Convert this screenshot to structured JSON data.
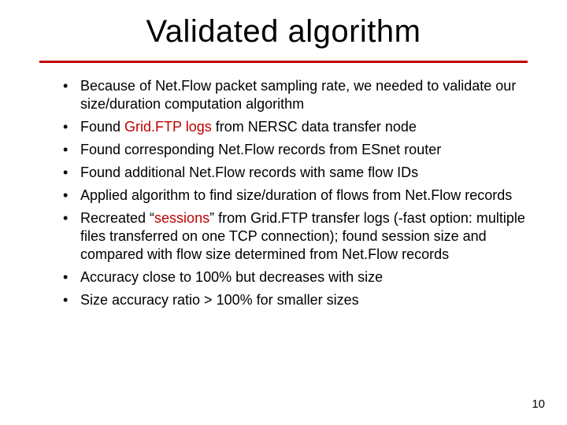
{
  "title": "Validated algorithm",
  "bullets": [
    {
      "pre": "Because of Net.Flow packet sampling rate, we needed to validate our size/duration computation algorithm"
    },
    {
      "pre": "Found ",
      "accent": "Grid.FTP logs",
      "post": " from NERSC data transfer node"
    },
    {
      "pre": "Found corresponding Net.Flow records from ESnet router"
    },
    {
      "pre": "Found additional Net.Flow records with same flow IDs"
    },
    {
      "pre": "Applied algorithm to find size/duration of flows from Net.Flow records"
    },
    {
      "pre": "Recreated “",
      "accent": "sessions",
      "post": "” from Grid.FTP transfer logs (-fast option: multiple files transferred on one TCP connection); found session size and compared with flow size determined from Net.Flow records"
    },
    {
      "pre": "Accuracy close to 100% but decreases with size"
    },
    {
      "pre": "Size accuracy ratio > 100% for smaller sizes"
    }
  ],
  "pageNumber": "10"
}
